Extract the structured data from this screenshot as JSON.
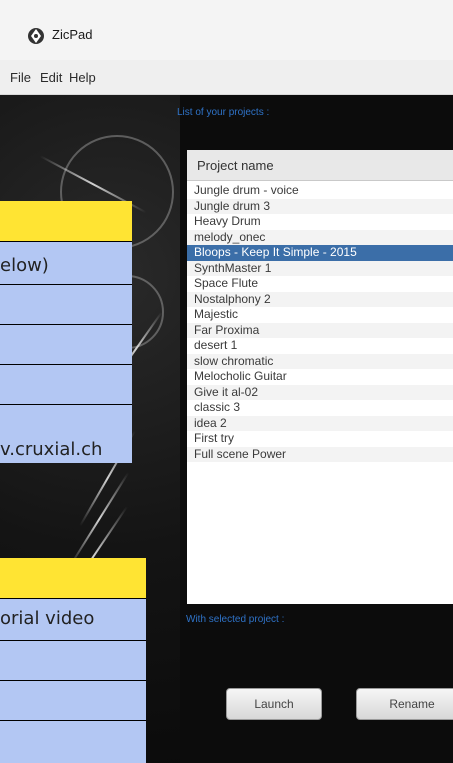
{
  "app": {
    "title": "ZicPad",
    "icon": "app-logo-icon"
  },
  "menu": [
    "File",
    "Edit",
    "Help"
  ],
  "panel": {
    "list_caption": "List of your projects :",
    "selected_caption": "With selected project :"
  },
  "project_list": {
    "header": "Project name",
    "rows": [
      "Jungle drum - voice",
      "Jungle drum 3",
      "Heavy Drum",
      "melody_onec",
      "Bloops - Keep It Simple - 2015",
      "SynthMaster 1",
      "Space Flute",
      "Nostalphony 2",
      "Majestic",
      "Far Proxima",
      "desert 1",
      "slow chromatic",
      "Melocholic Guitar",
      "Give it al-02",
      "classic 3",
      "idea 2",
      "First try",
      "Full scene Power"
    ],
    "selected": "Bloops - Keep It Simple - 2015"
  },
  "buttons": {
    "launch": "Launch",
    "rename": "Rename"
  },
  "overlay_top": {
    "rows": [
      "elow)",
      "",
      "",
      "v.cruxial.ch"
    ]
  },
  "overlay_bottom": {
    "rows": [
      "orial video",
      "",
      ""
    ]
  },
  "colors": {
    "overlay_fill": "#b3c7f3",
    "overlay_header": "#ffe433",
    "selection": "#3b6ea8",
    "caption": "#2f73c8"
  }
}
